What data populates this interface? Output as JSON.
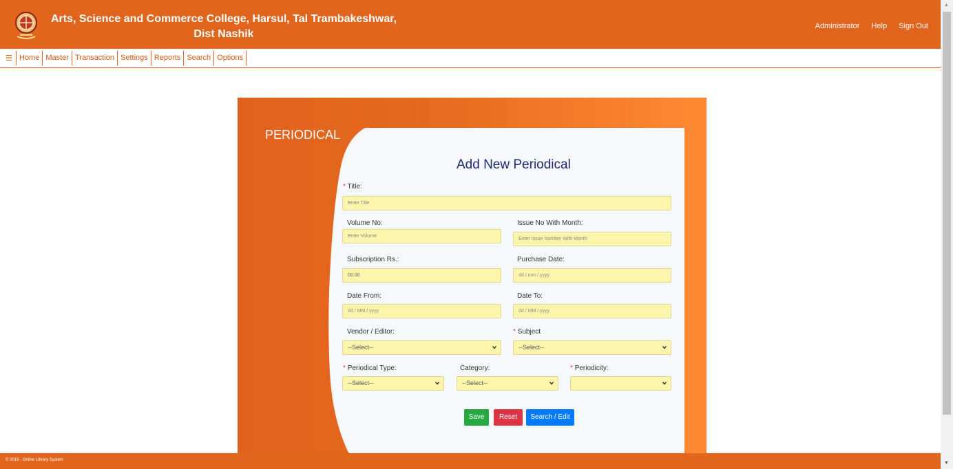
{
  "header": {
    "college_line1": "Arts, Science and Commerce College, Harsul, Tal Trambakeshwar,",
    "college_line2": "Dist Nashik",
    "links": [
      "Administrator",
      "Help",
      "Sign Out"
    ]
  },
  "menu": {
    "hamburger": "☰",
    "items": [
      "Home",
      "Master",
      "Transaction",
      "Settings",
      "Reports",
      "Search",
      "Options"
    ]
  },
  "card": {
    "title": "PERIODICAL",
    "form_title": "Add New Periodical"
  },
  "form": {
    "title": {
      "label": "Title:",
      "placeholder": "Enter Title",
      "required": true
    },
    "volume": {
      "label": "Volume No:",
      "placeholder": "Enter Volume"
    },
    "issue": {
      "label": "Issue No With Month:",
      "placeholder": "Enter Issue Number With Month"
    },
    "subscription": {
      "label": "Subscription Rs.:",
      "value": "00.00"
    },
    "purchase_date": {
      "label": "Purchase Date:",
      "placeholder": "dd / mm / yyyy"
    },
    "date_from": {
      "label": "Date From:",
      "placeholder": "dd / MM / yyyy"
    },
    "date_to": {
      "label": "Date To:",
      "placeholder": "dd / MM / yyyy"
    },
    "vendor": {
      "label": "Vendor / Editor:",
      "selected": "--Select--"
    },
    "subject": {
      "label": "Subject",
      "selected": "--Select--",
      "required": true
    },
    "periodical_type": {
      "label": "Periodical Type:",
      "selected": "--Select--",
      "required": true
    },
    "category": {
      "label": "Category:",
      "selected": "--Select--"
    },
    "periodicity": {
      "label": "Periodicity:",
      "selected": "",
      "required": true
    }
  },
  "buttons": {
    "save": "Save",
    "reset": "Reset",
    "search_edit": "Search / Edit"
  },
  "colors": {
    "brand_orange": "#e2651d",
    "input_bg": "#fbf6ac",
    "save": "#28a745",
    "reset": "#dc3545",
    "search": "#007bff",
    "form_title": "#1e2a78"
  },
  "footer": {
    "text": "© 2019 - Online Library System"
  }
}
